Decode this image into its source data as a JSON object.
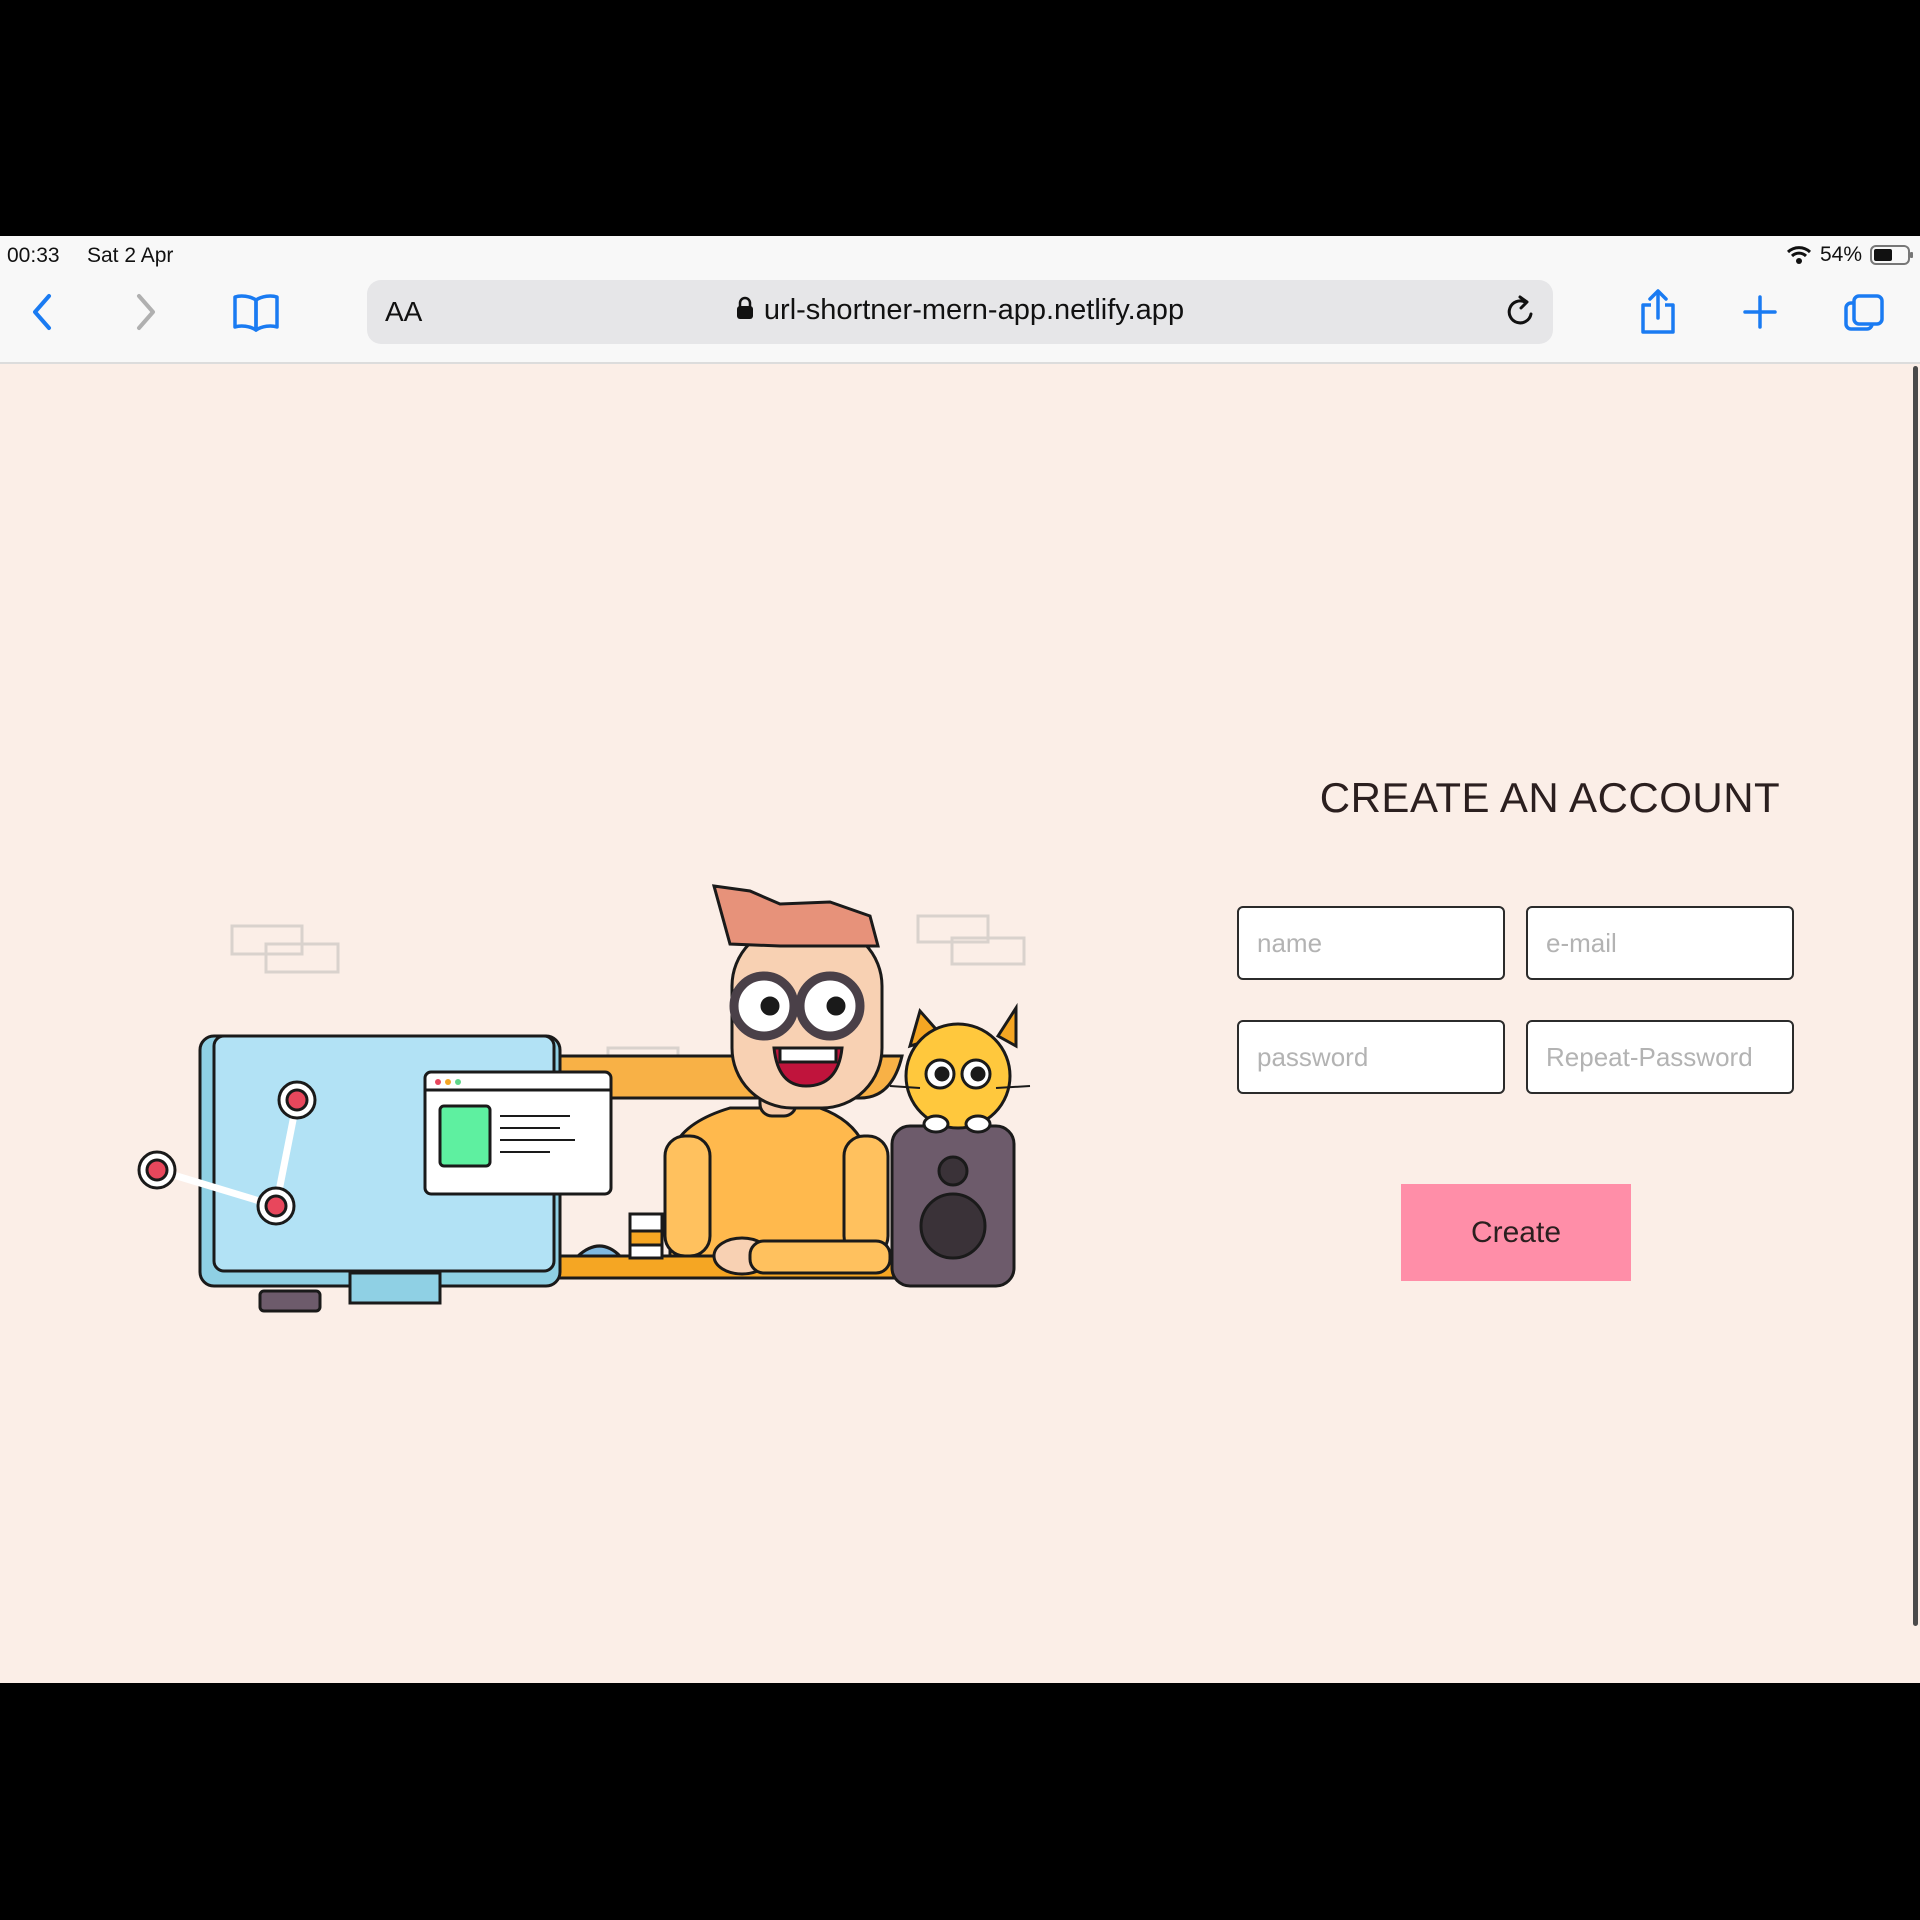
{
  "status_bar": {
    "time": "00:33",
    "date": "Sat 2 Apr",
    "battery": "54%"
  },
  "browser": {
    "reader_label": "AA",
    "url": "url-shortner-mern-app.netlify.app"
  },
  "form": {
    "title": "CREATE AN ACCOUNT",
    "name_placeholder": "name",
    "email_placeholder": "e-mail",
    "password_placeholder": "password",
    "repeat_password_placeholder": "Repeat-Password",
    "submit_label": "Create"
  },
  "colors": {
    "page_background": "#fbeee7",
    "button": "#ff8ea8",
    "accent_blue": "#1a7bf2"
  }
}
